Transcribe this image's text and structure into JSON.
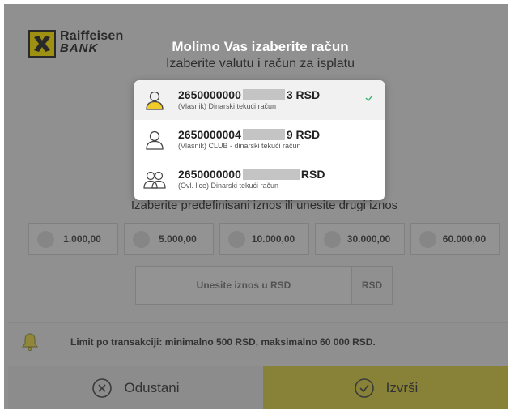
{
  "brand": {
    "name": "Raiffeisen",
    "sub": "BANK"
  },
  "header": {
    "title": "Molimo Vas izaberite račun",
    "subtitle": "Izaberite valutu i račun za isplatu"
  },
  "accounts": [
    {
      "number_prefix": "2650000000",
      "number_suffix": "3 RSD",
      "description": "(Vlasnik) Dinarski tekući račun",
      "icon": "user-icon",
      "selected": true
    },
    {
      "number_prefix": "2650000004",
      "number_suffix": "9 RSD",
      "description": "(Vlasnik) CLUB - dinarski tekući račun",
      "icon": "user-icon",
      "selected": false
    },
    {
      "number_prefix": "2650000000",
      "number_suffix": "RSD",
      "description": "(Ovl. lice) Dinarski tekući račun",
      "icon": "users-icon",
      "selected": false
    }
  ],
  "amount": {
    "label": "Izaberite predefinisani iznos ili unesite drugi iznos",
    "options": [
      "1.000,00",
      "5.000,00",
      "10.000,00",
      "30.000,00",
      "60.000,00"
    ],
    "input_placeholder": "Unesite iznos u RSD",
    "currency": "RSD"
  },
  "limit": {
    "text": "Limit po transakciji: minimalno 500 RSD, maksimalno 60 000 RSD.",
    "icon": "bell-icon"
  },
  "footer": {
    "cancel_label": "Odustani",
    "submit_label": "Izvrši"
  },
  "colors": {
    "brand_yellow": "#fee600",
    "submit": "#d8cc47",
    "check": "#3cb371"
  }
}
